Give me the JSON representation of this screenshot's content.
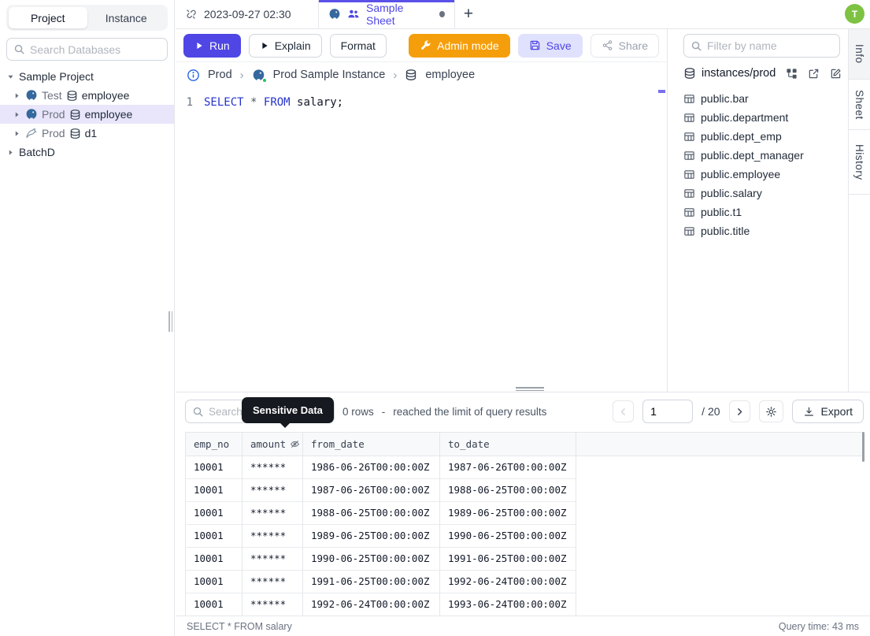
{
  "sidebar": {
    "tabs": [
      {
        "label": "Project"
      },
      {
        "label": "Instance"
      }
    ],
    "search_placeholder": "Search Databases",
    "tree": {
      "project": "Sample Project",
      "items": [
        {
          "env": "Test",
          "db": "employee",
          "engine": "postgres"
        },
        {
          "env": "Prod",
          "db": "employee",
          "engine": "postgres",
          "selected": true
        },
        {
          "env": "Prod",
          "db": "d1",
          "engine": "mysql"
        }
      ],
      "batch": "BatchD"
    }
  },
  "header": {
    "avatar": "T"
  },
  "tabbar": {
    "timestamp_tab": "2023-09-27 02:30",
    "sheet_tab": "Sample Sheet",
    "new_tab": "+"
  },
  "toolbar": {
    "run": "Run",
    "explain": "Explain",
    "format": "Format",
    "admin_mode": "Admin mode",
    "save": "Save",
    "share": "Share"
  },
  "breadcrumb": {
    "env": "Prod",
    "instance": "Prod Sample Instance",
    "database": "employee"
  },
  "editor": {
    "line_number": "1",
    "sql": {
      "select": "SELECT",
      "star": "*",
      "from": "FROM",
      "rest": "salary;"
    }
  },
  "right_panel": {
    "filter_placeholder": "Filter by name",
    "schema_path": "instances/prod",
    "tables": [
      "public.bar",
      "public.department",
      "public.dept_emp",
      "public.dept_manager",
      "public.employee",
      "public.salary",
      "public.t1",
      "public.title"
    ]
  },
  "right_rail": {
    "tabs": [
      "Info",
      "Sheet",
      "History"
    ]
  },
  "results": {
    "search_placeholder": "Search",
    "tooltip": "Sensitive Data",
    "rows_info": "0 rows",
    "dash": "-",
    "limit_info": "reached the limit of query results",
    "page": "1",
    "page_total": "/ 20",
    "export_label": "Export",
    "table": {
      "columns": [
        "emp_no",
        "amount",
        "from_date",
        "to_date"
      ],
      "rows": [
        [
          "10001",
          "******",
          "1986-06-26T00:00:00Z",
          "1987-06-26T00:00:00Z"
        ],
        [
          "10001",
          "******",
          "1987-06-26T00:00:00Z",
          "1988-06-25T00:00:00Z"
        ],
        [
          "10001",
          "******",
          "1988-06-25T00:00:00Z",
          "1989-06-25T00:00:00Z"
        ],
        [
          "10001",
          "******",
          "1989-06-25T00:00:00Z",
          "1990-06-25T00:00:00Z"
        ],
        [
          "10001",
          "******",
          "1990-06-25T00:00:00Z",
          "1991-06-25T00:00:00Z"
        ],
        [
          "10001",
          "******",
          "1991-06-25T00:00:00Z",
          "1992-06-24T00:00:00Z"
        ],
        [
          "10001",
          "******",
          "1992-06-24T00:00:00Z",
          "1993-06-24T00:00:00Z"
        ]
      ]
    },
    "status_left": "SELECT * FROM salary",
    "status_right": "Query time: 43 ms"
  },
  "colors": {
    "accent": "#4f46e5",
    "admin_mode": "#f59e0b",
    "save_bg": "#e0e1fc",
    "selected_row_bg": "#e9e6fb",
    "tooltip_bg": "#16191f",
    "avatar_bg": "#7dc242",
    "sql_keyword": "#2533cc",
    "status_ok": "#22c55e"
  }
}
